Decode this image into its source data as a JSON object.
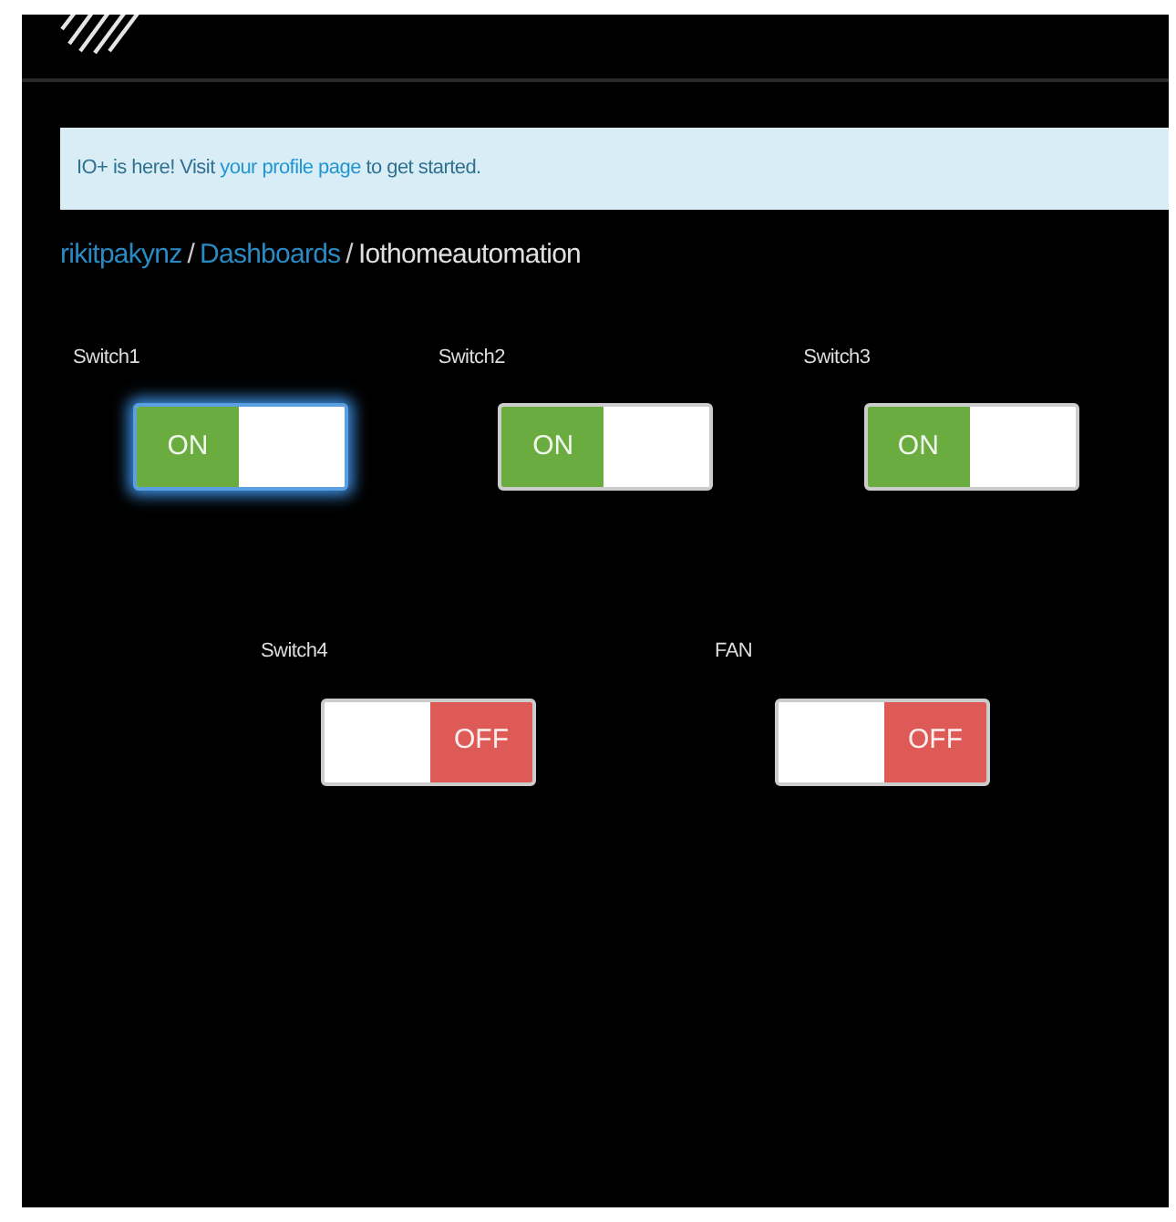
{
  "banner": {
    "text": "IO+ is here! Visit ",
    "link": "your profile page",
    "after": " to get started."
  },
  "breadcrumb": [
    {
      "label": "rikitpakynz",
      "link": true
    },
    {
      "label": "Dashboards",
      "link": true
    },
    {
      "label": "Iothomeautomation",
      "link": false
    }
  ],
  "separator": "/",
  "switch_rows": [
    [
      {
        "label": "Switch1",
        "on": true,
        "state_text": "ON",
        "focused": true
      },
      {
        "label": "Switch2",
        "on": true,
        "state_text": "ON",
        "focused": false
      },
      {
        "label": "Switch3",
        "on": true,
        "state_text": "ON",
        "focused": false
      }
    ],
    [
      {
        "label": "Switch4",
        "on": false,
        "state_text": "OFF",
        "focused": false
      },
      {
        "label": "FAN",
        "on": false,
        "state_text": "OFF",
        "focused": false
      }
    ]
  ]
}
